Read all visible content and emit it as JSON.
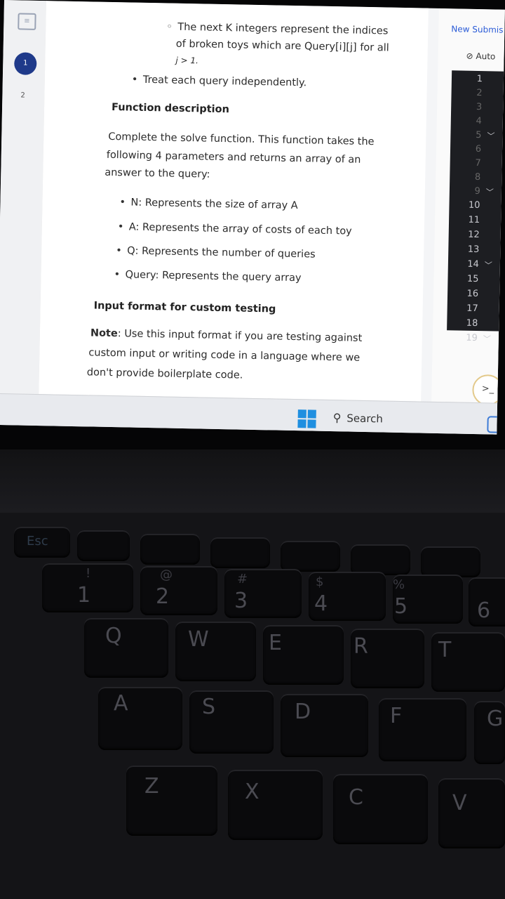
{
  "problem": {
    "subbullet_1a": "The next K integers represent the indices",
    "subbullet_1b": "of broken toys which are Query[i][j] for all",
    "subbullet_1c": "j > 1.",
    "bullet_independent": "Treat each query independently.",
    "function_heading": "Function description",
    "desc_1": "Complete the solve function. This function takes the",
    "desc_2": "following 4 parameters and returns an array of an",
    "desc_3": "answer to the query:",
    "params": [
      "N: Represents the size of array A",
      "A: Represents the array of costs of each toy",
      "Q: Represents the number of queries",
      "Query: Represents the query array"
    ],
    "input_heading": "Input format for custom testing",
    "note_label": "Note",
    "note_1": ": Use this input format if you are testing against",
    "note_2": "custom input or writing code in a language where we",
    "note_3": "don't provide boilerplate code."
  },
  "left_rail": {
    "badge": "1",
    "number": "2"
  },
  "right_panel": {
    "new_submission": "New Submis",
    "auto": "Auto",
    "auto_icon": "check-circle-icon",
    "line_numbers": [
      "1",
      "2",
      "3",
      "4",
      "5",
      "6",
      "7",
      "8",
      "9",
      "10",
      "11",
      "12",
      "13",
      "14",
      "15",
      "16",
      "17",
      "18",
      "19"
    ]
  },
  "taskbar": {
    "search_label": "Search",
    "start_icon": "windows-logo-icon",
    "search_icon": "search-icon"
  },
  "keyboard": {
    "row1": [
      {
        "main": "1",
        "sub": "!"
      },
      {
        "main": "2",
        "sub": "@"
      },
      {
        "main": "3",
        "sub": "#"
      },
      {
        "main": "4",
        "sub": "$"
      },
      {
        "main": "5",
        "sub": "%"
      },
      {
        "main": "6",
        "sub": ""
      }
    ],
    "row2": [
      "Q",
      "W",
      "E",
      "R",
      "T"
    ],
    "row3": [
      "A",
      "S",
      "D",
      "F",
      "G"
    ],
    "row4": [
      "Z",
      "X",
      "C",
      "V"
    ],
    "esc": "Esc"
  },
  "colors": {
    "accent": "#1f3a8a",
    "link": "#2a5bd7",
    "editor_bg": "#1d1e22",
    "windows_blue": "#1f8fe0"
  }
}
